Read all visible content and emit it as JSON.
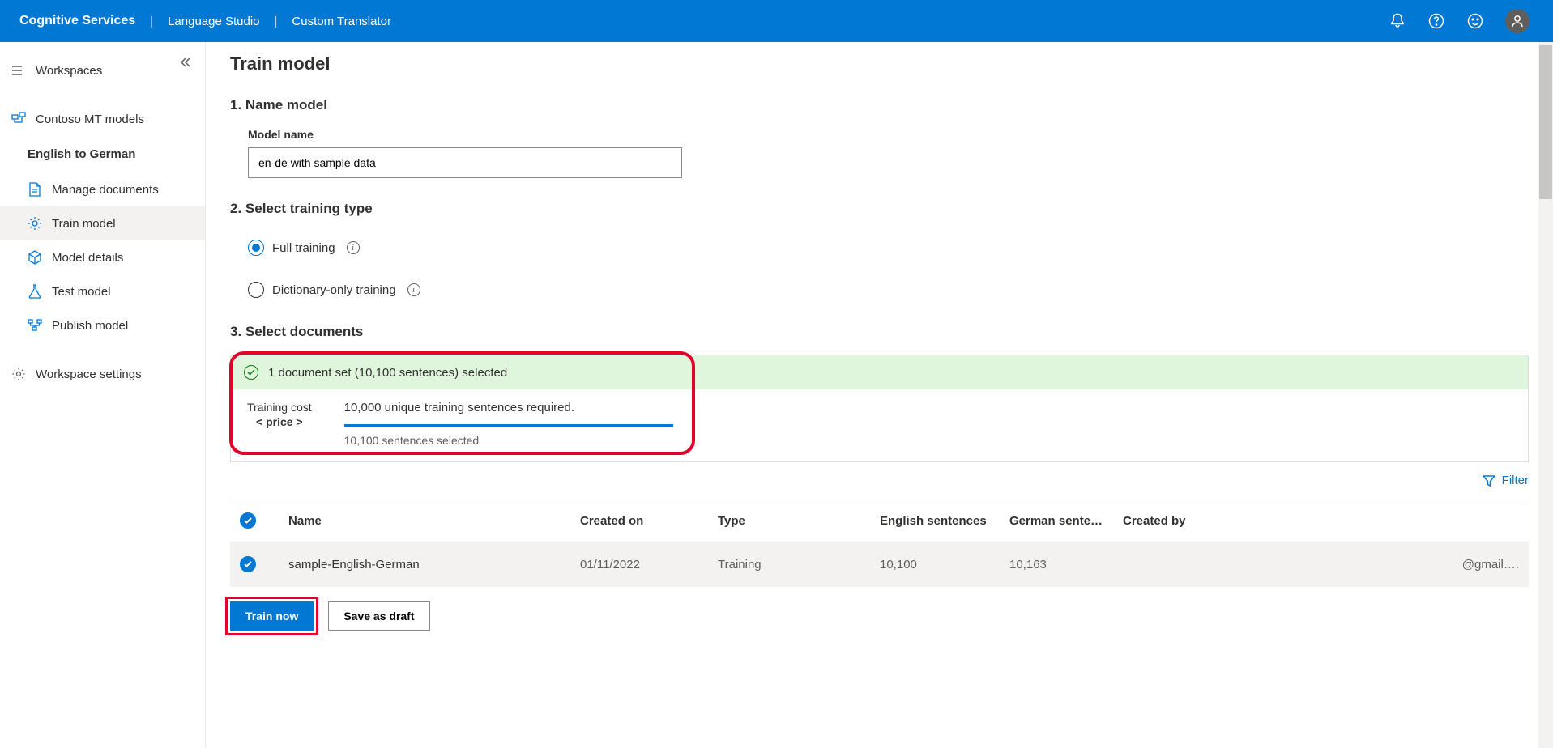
{
  "header": {
    "service": "Cognitive Services",
    "studio": "Language Studio",
    "app": "Custom Translator"
  },
  "sidebar": {
    "workspaces": "Workspaces",
    "workspace_name": "Contoso MT models",
    "project_name": "English to German",
    "items": [
      {
        "label": "Manage documents"
      },
      {
        "label": "Train model"
      },
      {
        "label": "Model details"
      },
      {
        "label": "Test model"
      },
      {
        "label": "Publish model"
      }
    ],
    "settings": "Workspace settings"
  },
  "page": {
    "title": "Train model",
    "step1": {
      "heading": "1. Name model",
      "field_label": "Model name",
      "value": "en-de with sample data"
    },
    "step2": {
      "heading": "2. Select training type",
      "options": [
        {
          "label": "Full training",
          "selected": true
        },
        {
          "label": "Dictionary-only training",
          "selected": false
        }
      ]
    },
    "step3": {
      "heading": "3. Select documents",
      "status": "1 document set (10,100 sentences) selected",
      "cost_label": "Training cost",
      "cost_value": "< price >",
      "requirement": "10,000 unique training sentences required.",
      "selected_text": "10,100 sentences selected",
      "filter": "Filter",
      "columns": {
        "name": "Name",
        "created": "Created on",
        "type": "Type",
        "eng": "English sentences",
        "ger": "German sente…",
        "by": "Created by"
      },
      "rows": [
        {
          "name": "sample-English-German",
          "created": "01/11/2022",
          "type": "Training",
          "eng": "10,100",
          "ger": "10,163",
          "by": "@gmail…."
        }
      ]
    },
    "actions": {
      "train": "Train now",
      "save": "Save as draft"
    }
  }
}
